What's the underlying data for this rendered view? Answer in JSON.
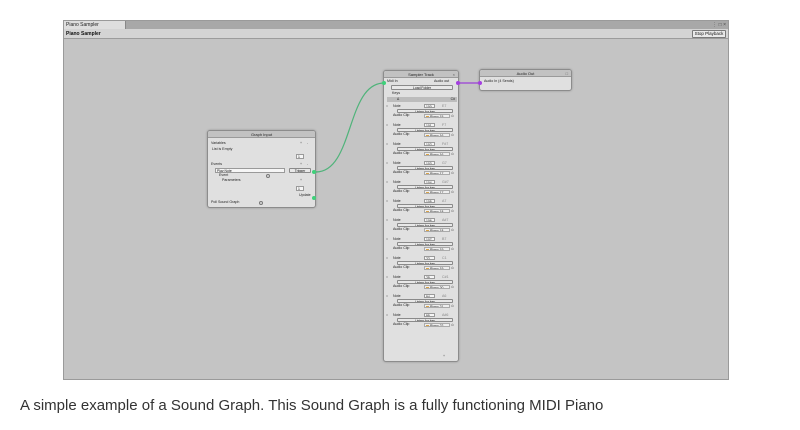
{
  "window": {
    "tab_label": "Piano Sampler",
    "controls": "⋮ □ ×",
    "title": "Piano Sampler",
    "stop_button": "Stop Playback"
  },
  "graph_input": {
    "title": "Graph Input",
    "variables_label": "Variables",
    "list_empty": "List is Empty",
    "events_label": "Events",
    "event_name": "Play Note",
    "event_trigger": "Trigger",
    "event_type": "Event",
    "parameters_label": "Parameters",
    "update_label": "Update",
    "poll_label": "Poll Sound Graph",
    "plus": "+",
    "minus": "-",
    "one": "1"
  },
  "sampler": {
    "title": "Sampler Track",
    "midi_in": "Midi In",
    "audio_out": "Audio out",
    "load_folder": "Load Folder",
    "keys_label": "Keys",
    "header_mid": "Δ",
    "header_right": "C#",
    "note_label": "Note",
    "clip_label": "Audio Clip",
    "listen_label": "Listen for key",
    "add": "+",
    "keys": [
      {
        "note": "100",
        "name": "E7",
        "clip": "Piano 15"
      },
      {
        "note": "101",
        "name": "F7",
        "clip": "Piano 16"
      },
      {
        "note": "102",
        "name": "F#7",
        "clip": "Piano 16"
      },
      {
        "note": "103",
        "name": "G7",
        "clip": "Piano 17"
      },
      {
        "note": "104",
        "name": "G#7",
        "clip": "Piano 17"
      },
      {
        "note": "105",
        "name": "A7",
        "clip": "Piano 18"
      },
      {
        "note": "106",
        "name": "A#7",
        "clip": "Piano 18"
      },
      {
        "note": "107",
        "name": "B7",
        "clip": "Piano 19"
      },
      {
        "note": "22",
        "name": "C1",
        "clip": "Piano 19"
      },
      {
        "note": "25",
        "name": "C#1",
        "clip": "Piano 20"
      },
      {
        "note": "94",
        "name": "A6",
        "clip": "Piano 21"
      },
      {
        "note": "95",
        "name": "A#6",
        "clip": "Piano 22"
      }
    ]
  },
  "audio_out": {
    "title": "Audio Out",
    "input_label": "Audio In (4 Sends)"
  },
  "caption": "A simple example of a Sound Graph. This Sound Graph is a fully functioning MIDI Piano",
  "colors": {
    "connection": "#4fb37a",
    "audio_link": "#9b3fd6",
    "port_green": "#3ed17a",
    "port_purple": "#a43ee0"
  }
}
